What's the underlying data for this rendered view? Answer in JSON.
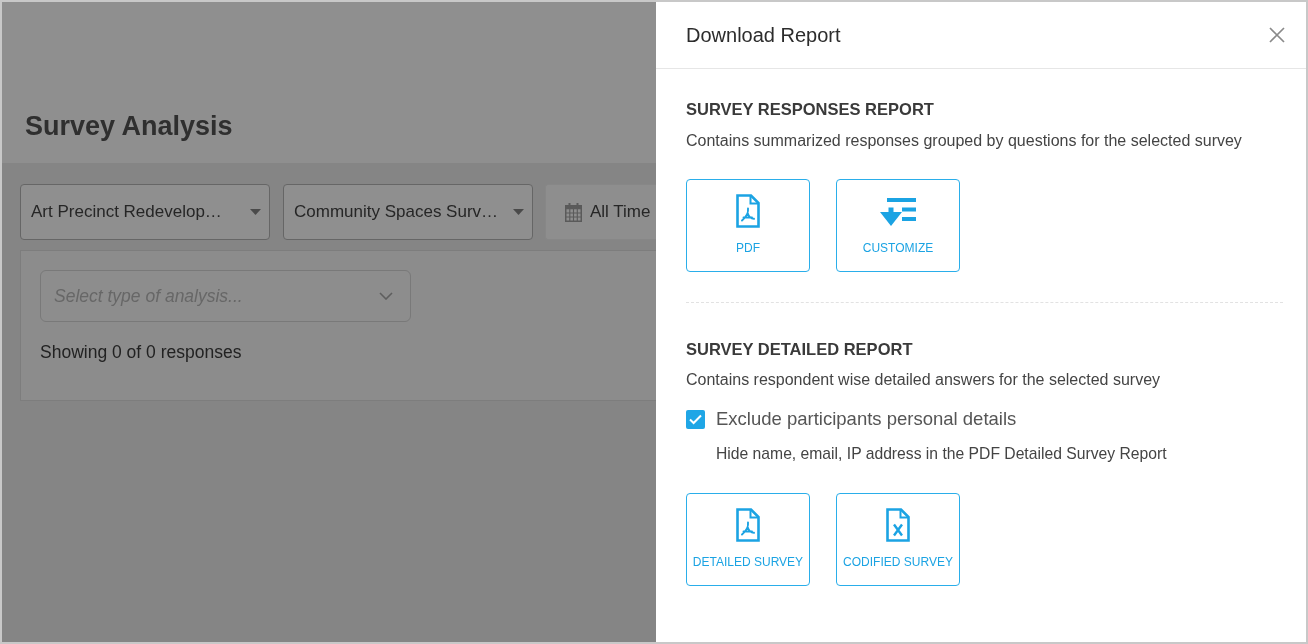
{
  "page": {
    "title": "Survey Analysis",
    "filters": [
      {
        "kind": "dropdown",
        "value": "Art Precinct Redevelop…"
      },
      {
        "kind": "dropdown",
        "value": "Community Spaces Surv…"
      },
      {
        "kind": "date",
        "value": "All Time"
      }
    ],
    "analysis_select": {
      "placeholder": "Select type of analysis..."
    },
    "response_count": "Showing 0 of 0 responses"
  },
  "drawer": {
    "title": "Download Report",
    "sections": [
      {
        "heading": "SURVEY RESPONSES REPORT",
        "description": "Contains summarized responses grouped by questions for the selected survey",
        "downloads": [
          {
            "kind": "pdf",
            "label": "PDF"
          },
          {
            "kind": "customize",
            "label": "CUSTOMIZE"
          }
        ]
      },
      {
        "heading": "SURVEY DETAILED REPORT",
        "description": "Contains respondent wise detailed answers for the selected survey",
        "option": {
          "label": "Exclude participants personal details",
          "checked": true,
          "hint": "Hide name, email, IP address in the PDF Detailed Survey Report"
        },
        "downloads": [
          {
            "kind": "pdf",
            "label": "DETAILED SURVEY"
          },
          {
            "kind": "excel",
            "label": "CODIFIED SURVEY"
          }
        ]
      }
    ]
  }
}
